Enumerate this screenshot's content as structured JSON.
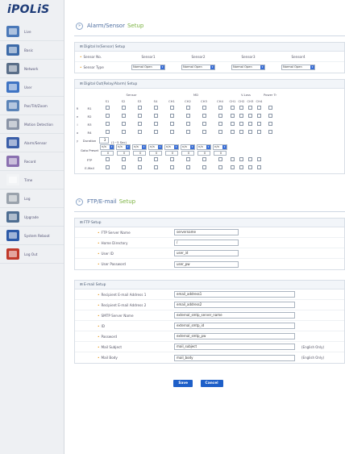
{
  "logo": "iPOLiS",
  "sidebar": {
    "items": [
      {
        "label": "Live",
        "icon": "live-icon",
        "color": "#4a78b8"
      },
      {
        "label": "Basic",
        "icon": "monitor-icon",
        "color": "#3c6aa8"
      },
      {
        "label": "Network",
        "icon": "network-icon",
        "color": "#5a6e88"
      },
      {
        "label": "User",
        "icon": "user-icon",
        "color": "#3f74c4"
      },
      {
        "label": "Pan/Tilt/Zoom",
        "icon": "ptz-icon",
        "color": "#5b84b8"
      },
      {
        "label": "Motion Detection",
        "icon": "motion-icon",
        "color": "#8a94a6"
      },
      {
        "label": "Alarm/Sensor",
        "icon": "alarm-icon",
        "color": "#3a5ea8"
      },
      {
        "label": "Record",
        "icon": "record-icon",
        "color": "#8a70b0"
      },
      {
        "label": "Time",
        "icon": "clock-icon",
        "color": "#f2f4f6"
      },
      {
        "label": "Log",
        "icon": "log-icon",
        "color": "#9aa2ac"
      },
      {
        "label": "Upgrade",
        "icon": "upgrade-icon",
        "color": "#4f6e92"
      },
      {
        "label": "System Reboot",
        "icon": "reboot-icon",
        "color": "#2d5aa8"
      },
      {
        "label": "Log Out",
        "icon": "logout-icon",
        "color": "#c0392b"
      }
    ]
  },
  "alarm": {
    "title_a": "Alarm/Sensor",
    "title_b": "Setup",
    "din": {
      "header": "Digital In(Sensor) Setup",
      "no_label": "Sensor No.",
      "type_label": "Sensor Type",
      "sensors": [
        "Sensor1",
        "Sensor2",
        "Sensor3",
        "Sensor4"
      ],
      "types": [
        "Normal Open",
        "Normal Open",
        "Normal Open",
        "Normal Open"
      ]
    },
    "dout": {
      "header": "Digital Out(Relay/Alarm) Setup",
      "group_sensor": "Sensor",
      "group_md": "MD",
      "group_vloss": "V-Loss",
      "group_power": "Power Tr",
      "side_letters": [
        "R",
        "e",
        "l",
        "a",
        "y"
      ],
      "cols": [
        "S1",
        "S2",
        "S3",
        "S4",
        "CH1",
        "CH2",
        "CH3",
        "CH4",
        "CH1",
        "CH2",
        "CH3",
        "CH4"
      ],
      "rows": [
        "R1",
        "R2",
        "R3",
        "R4"
      ],
      "duration_label": "Duration",
      "duration_value": "3",
      "duration_hint": "(1~5 Sec)",
      "goto_label": "Goto Preset",
      "goto_values": [
        "n/a",
        "n/a",
        "n/a",
        "n/a",
        "n/a",
        "n/a",
        "n/a",
        "n/a"
      ],
      "preset_values": [
        "0",
        "0",
        "0",
        "0",
        "0",
        "0",
        "0",
        "0"
      ],
      "ftp_label": "FTP",
      "email_label": "E-Mail"
    }
  },
  "ftp": {
    "title_a": "FTP/E-mail",
    "title_b": "Setup",
    "box_header": "FTP Setup",
    "fields": [
      {
        "label": "FTP Server Name",
        "value": "servername"
      },
      {
        "label": "Home Directory",
        "value": "/"
      },
      {
        "label": "User ID",
        "value": "user_id"
      },
      {
        "label": "User Password",
        "value": "user_pw"
      }
    ]
  },
  "email": {
    "box_header": "E-mail Setup",
    "fields": [
      {
        "label": "Recipient E-mail Address 1",
        "value": "email_address1",
        "note": ""
      },
      {
        "label": "Recipient E-mail Address 2",
        "value": "email_address2",
        "note": ""
      },
      {
        "label": "SMTP Server Name",
        "value": "external_smtp_server_name",
        "note": ""
      },
      {
        "label": "ID",
        "value": "external_smtp_id",
        "note": ""
      },
      {
        "label": "Password",
        "value": "external_smtp_pw",
        "note": ""
      },
      {
        "label": "Mail Subject",
        "value": "mail_subject",
        "note": "(English Only)"
      },
      {
        "label": "Mail Body",
        "value": "mail_body",
        "note": "(English Only)"
      }
    ]
  },
  "buttons": {
    "save": "Save",
    "cancel": "Cancel"
  }
}
